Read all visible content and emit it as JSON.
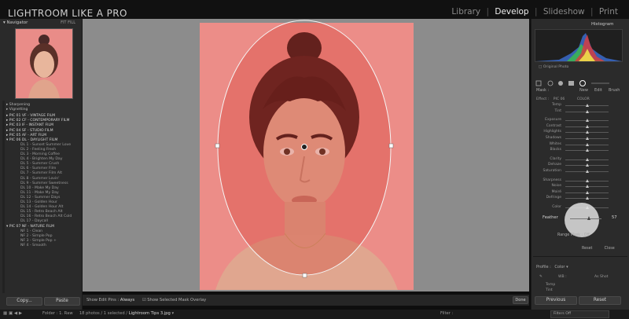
{
  "app": {
    "title": "LIGHTROOM LIKE A PRO"
  },
  "modules": {
    "library": "Library",
    "develop": "Develop",
    "slideshow": "Slideshow",
    "print": "Print",
    "active": "Develop"
  },
  "navigator": {
    "title": "Navigator",
    "zoom_options": "FIT  FILL"
  },
  "presets": {
    "top_items": [
      "Sharpening",
      "Vignetting"
    ],
    "groups": [
      {
        "label": "PIC 01 VF  - VINTAGE FILM"
      },
      {
        "label": "PIC 02 CF  - CONTEMPORARY FILM"
      },
      {
        "label": "PIC 03 IF  - INSTANT FILM"
      },
      {
        "label": "PIC 04 SF  - STUDIO FILM"
      },
      {
        "label": "PIC 05 AF  - ART FILM"
      },
      {
        "label": "PIC 06 DL  - DAYLIGHT FILM"
      }
    ],
    "daylight_items": [
      "DL 1 - Sunset Summer Love",
      "DL 2 - Feeling Fresh",
      "DL 3 - Morning Coffee",
      "DL 4 - Brighten My Day",
      "DL 5 - Summer Crush",
      "DL 6 - Summer Film",
      "DL 7 - Summer Film Alt",
      "DL 8 - Summer Lovin'",
      "DL 9 - Summer Sweetness",
      "DL 10 - Make My Day",
      "DL 11 - Make My Day",
      "DL 12 - Summer Days",
      "DL 13 - Golden Hour",
      "DL 14 - Golden Hour Alt",
      "DL 15 - Retro Beach Alt",
      "DL 16 - Retro Beach Alt Cold",
      "DL 17 - Daycall"
    ],
    "nature_group": "PIC 07 NF  - NATURE FILM",
    "nature_items": [
      "NF 1 - Clean",
      "NF 2 - Simple Pop",
      "NF 3 - Simple Pop +",
      "NF 4 - Smooth"
    ]
  },
  "left_buttons": {
    "copy": "Copy...",
    "paste": "Paste"
  },
  "center_footer": {
    "show_edit_pins": "Show Edit Pins :",
    "show_edit_pins_value": "Always",
    "show_overlay": "Show Selected Mask Overlay",
    "done": "Done"
  },
  "histogram": {
    "title": "Histogram",
    "original_photo": "Original Photo"
  },
  "mask": {
    "label": "Mask :",
    "new": "New",
    "edit": "Edit",
    "brush": "Brush"
  },
  "effect": {
    "label": "Effect :",
    "preset": "PIC 06",
    "color": "COLOR"
  },
  "sliders": [
    {
      "label": "Temp",
      "value": 0.5
    },
    {
      "label": "Tint",
      "value": 0.5
    },
    {
      "label": "Exposure",
      "value": 0.5
    },
    {
      "label": "Contrast",
      "value": 0.5
    },
    {
      "label": "Highlights",
      "value": 0.5
    },
    {
      "label": "Shadows",
      "value": 0.5
    },
    {
      "label": "Whites",
      "value": 0.5
    },
    {
      "label": "Blacks",
      "value": 0.5
    },
    {
      "label": "Clarity",
      "value": 0.5
    },
    {
      "label": "Dehaze",
      "value": 0.5
    },
    {
      "label": "Saturation",
      "value": 0.5
    },
    {
      "label": "Sharpness",
      "value": 0.5
    },
    {
      "label": "Noise",
      "value": 0.5
    },
    {
      "label": "Moiré",
      "value": 0.5
    },
    {
      "label": "Defringe",
      "value": 0.5
    },
    {
      "label": "Color",
      "value": 0.5
    }
  ],
  "feather": {
    "label": "Feather",
    "value": "57",
    "level": 0.62
  },
  "range_mask": {
    "label": "Range Mask :",
    "value": "Off"
  },
  "panel_actions": {
    "reset": "Reset",
    "close": "Close"
  },
  "profile": {
    "label": "Profile :",
    "value": "Color"
  },
  "wb": {
    "label": "WB :",
    "value": "As Shot",
    "temp": "Temp",
    "tint": "Tint"
  },
  "right_buttons": {
    "previous": "Previous",
    "reset": "Reset"
  },
  "filmstrip": {
    "folder": "Folder : 1. Raw",
    "count": "18 photos / 1 selected /",
    "filename": "Lightroom Tips 3.jpg",
    "filter_label": "Filter :",
    "filter_value": "Filters Off"
  },
  "colors": {
    "photo_tint": "#ec8d88",
    "mask_overlay": "#d03020",
    "canvas_bg": "#8c8c8c",
    "panel_bg": "#2b2b2b"
  }
}
